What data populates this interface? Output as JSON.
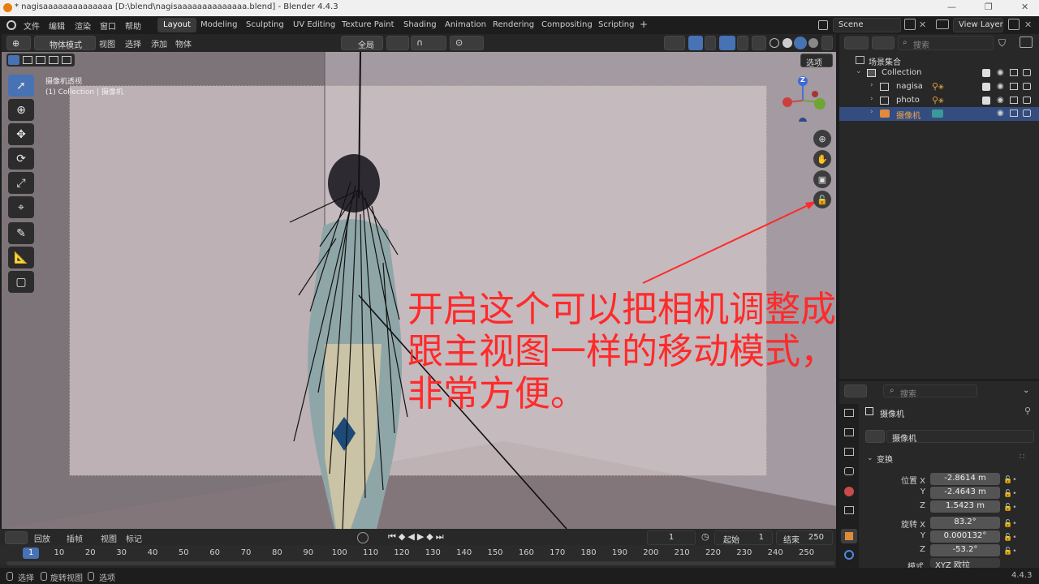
{
  "window": {
    "title": "* nagisaaaaaaaaaaaaaa [D:\\blend\\nagisaaaaaaaaaaaaaa.blend] - Blender 4.4.3",
    "controls": [
      "—",
      "❐",
      "✕"
    ]
  },
  "menu": [
    "文件",
    "编辑",
    "渲染",
    "窗口",
    "帮助"
  ],
  "workspaces": [
    {
      "label": "Layout",
      "active": true
    },
    {
      "label": "Modeling"
    },
    {
      "label": "Sculpting"
    },
    {
      "label": "UV Editing"
    },
    {
      "label": "Texture Paint"
    },
    {
      "label": "Shading"
    },
    {
      "label": "Animation"
    },
    {
      "label": "Rendering"
    },
    {
      "label": "Compositing"
    },
    {
      "label": "Scripting"
    }
  ],
  "add_workspace": "+",
  "scene": {
    "name": "Scene",
    "view_layer": "View Layer"
  },
  "viewport_header": {
    "mode": "物体模式",
    "menus": [
      "视图",
      "选择",
      "添加",
      "物体"
    ],
    "transform_orientation": "全局",
    "options_label": "选项"
  },
  "viewport": {
    "camera_label": "摄像机透视",
    "collection_label": "(1) Collection | 摄像机",
    "gizmo_z": "Z",
    "annotation_lines": [
      "开启这个可以把相机调整成",
      "跟主视图一样的移动模式，",
      "非常方便。"
    ],
    "annotation_color": "#ff2a2a",
    "background_color": "#6e6770"
  },
  "outliner": {
    "search_placeholder": "搜索",
    "root": "场景集合",
    "collection": "Collection",
    "items": [
      {
        "name": "nagisa",
        "selected": false
      },
      {
        "name": "photo",
        "selected": false
      },
      {
        "name": "摄像机",
        "selected": true
      }
    ]
  },
  "properties": {
    "search_placeholder": "搜索",
    "object_name": "摄像机",
    "data_name": "摄像机",
    "section": "变换",
    "location_label": "位置",
    "rotation_label": "旋转",
    "mode_label": "模式",
    "location": [
      {
        "axis": "X",
        "value": "-2.8614 m"
      },
      {
        "axis": "Y",
        "value": "-2.4643 m"
      },
      {
        "axis": "Z",
        "value": "1.5423 m"
      }
    ],
    "rotation": [
      {
        "axis": "X",
        "value": "83.2°"
      },
      {
        "axis": "Y",
        "value": "0.000132°"
      },
      {
        "axis": "Z",
        "value": "-53.2°"
      }
    ],
    "rotation_mode": "XYZ 欧拉"
  },
  "timeline": {
    "menus": [
      "回放",
      "插帧",
      "视图",
      "标记"
    ],
    "current_frame": "1",
    "start_label": "起始",
    "start": "1",
    "end_label": "结束",
    "end": "250",
    "ticks": [
      "1",
      "10",
      "20",
      "30",
      "40",
      "50",
      "60",
      "70",
      "80",
      "90",
      "100",
      "110",
      "120",
      "130",
      "140",
      "150",
      "160",
      "170",
      "180",
      "190",
      "200",
      "210",
      "220",
      "230",
      "240",
      "250"
    ]
  },
  "statusbar": {
    "items": [
      "选择",
      "旋转视图",
      "选项"
    ],
    "version": "4.4.3"
  }
}
